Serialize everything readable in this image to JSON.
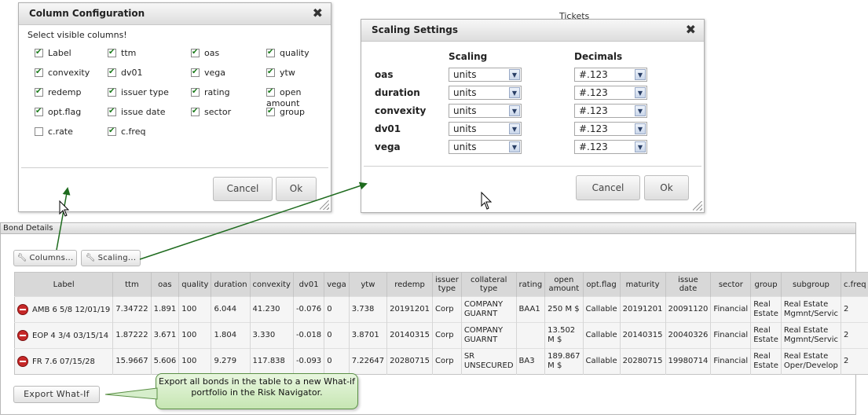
{
  "background_fragments": {
    "top_right": "Tickets"
  },
  "bond_details": {
    "title": "Bond Details",
    "columns_button": "Columns...",
    "scaling_button": "Scaling...",
    "export_button": "Export What-If",
    "headers": [
      "Label",
      "ttm",
      "oas",
      "quality",
      "duration",
      "convexity",
      "dv01",
      "vega",
      "ytw",
      "redemp",
      "issuer type",
      "collateral type",
      "rating",
      "open amount",
      "opt.flag",
      "maturity",
      "issue date",
      "sector",
      "group",
      "subgroup",
      "c.freq"
    ],
    "rows": [
      [
        "AMB 6 5/8 12/01/19",
        "7.34722",
        "1.891",
        "100",
        "6.044",
        "41.230",
        "-0.076",
        "0",
        "3.738",
        "20191201",
        "Corp",
        "COMPANY GUARNT",
        "BAA1",
        "250 M $",
        "Callable",
        "20191201",
        "20091120",
        "Financial",
        "Real Estate",
        "Real Estate Mgmnt/Servic",
        "2"
      ],
      [
        "EOP 4 3/4 03/15/14",
        "1.87222",
        "3.671",
        "100",
        "1.804",
        "3.330",
        "-0.018",
        "0",
        "3.8701",
        "20140315",
        "Corp",
        "COMPANY GUARNT",
        "",
        "13.502 M $",
        "Callable",
        "20140315",
        "20040326",
        "Financial",
        "Real Estate",
        "Real Estate Mgmnt/Servic",
        "2"
      ],
      [
        "FR 7.6 07/15/28",
        "15.9667",
        "5.606",
        "100",
        "9.279",
        "117.838",
        "-0.093",
        "0",
        "7.22647",
        "20280715",
        "Corp",
        "SR UNSECURED",
        "BA3",
        "189.867 M $",
        "Callable",
        "20280715",
        "19980714",
        "Financial",
        "Real Estate",
        "Real Estate Oper/Develop",
        "2"
      ]
    ]
  },
  "column_config": {
    "title": "Column Configuration",
    "prompt": "Select visible columns!",
    "items": [
      {
        "label": "Label",
        "checked": true
      },
      {
        "label": "ttm",
        "checked": true
      },
      {
        "label": "oas",
        "checked": true
      },
      {
        "label": "quality",
        "checked": true
      },
      {
        "label": "convexity",
        "checked": true
      },
      {
        "label": "dv01",
        "checked": true
      },
      {
        "label": "vega",
        "checked": true
      },
      {
        "label": "ytw",
        "checked": true
      },
      {
        "label": "redemp",
        "checked": true
      },
      {
        "label": "issuer type",
        "checked": true
      },
      {
        "label": "rating",
        "checked": true
      },
      {
        "label": "open amount",
        "checked": true
      },
      {
        "label": "opt.flag",
        "checked": true
      },
      {
        "label": "issue date",
        "checked": true
      },
      {
        "label": "sector",
        "checked": true
      },
      {
        "label": "group",
        "checked": true
      },
      {
        "label": "c.rate",
        "checked": false
      },
      {
        "label": "c.freq",
        "checked": true
      }
    ],
    "cancel": "Cancel",
    "ok": "Ok"
  },
  "scaling_settings": {
    "title": "Scaling Settings",
    "scaling_header": "Scaling",
    "decimals_header": "Decimals",
    "rows": [
      {
        "label": "oas",
        "scaling": "units",
        "decimals": "#.123"
      },
      {
        "label": "duration",
        "scaling": "units",
        "decimals": "#.123"
      },
      {
        "label": "convexity",
        "scaling": "units",
        "decimals": "#.123"
      },
      {
        "label": "dv01",
        "scaling": "units",
        "decimals": "#.123"
      },
      {
        "label": "vega",
        "scaling": "units",
        "decimals": "#.123"
      }
    ],
    "cancel": "Cancel",
    "ok": "Ok"
  },
  "callout": {
    "text": "Export all bonds in the table to a new What-if portfolio in the Risk Navigator."
  },
  "colors": {
    "arrow": "#1e6b1e",
    "callout_border": "#5a8f45",
    "delete_icon": "#c62828"
  }
}
